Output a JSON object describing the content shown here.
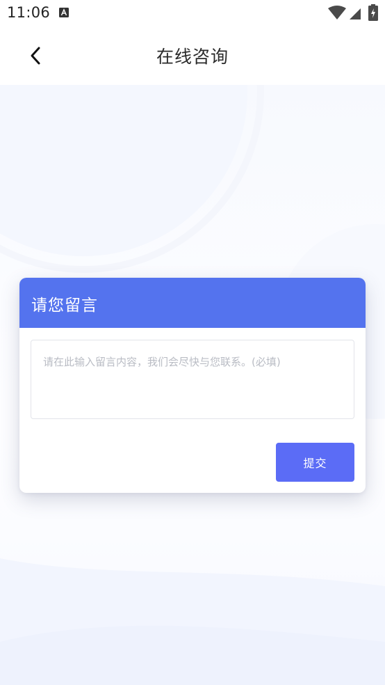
{
  "status_bar": {
    "time": "11:06",
    "icons": [
      "text-a-icon",
      "wifi-icon",
      "signal-icon",
      "battery-charging-icon"
    ]
  },
  "nav": {
    "back_icon": "chevron-left-icon",
    "title": "在线咨询"
  },
  "message_card": {
    "title": "请您留言",
    "input_value": "",
    "input_placeholder": "请在此输入留言内容，我们会尽快与您联系。(必填)",
    "submit_label": "提交"
  },
  "colors": {
    "header_blue": "#5473ee",
    "button_blue": "#5b6cf6",
    "placeholder_gray": "#b9bcc4",
    "background_tint": "#f7f9fe"
  }
}
